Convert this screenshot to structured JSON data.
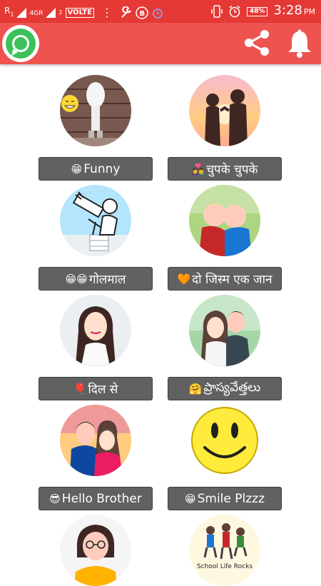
{
  "status_bar": {
    "sim1": "R",
    "sim1_sub": "1",
    "network": "4G",
    "network_r": "R",
    "sim2_sub": "2",
    "volte": "VOLTE",
    "battery": "48%",
    "time": "3:28",
    "ampm": "PM"
  },
  "app_bar": {
    "logo_icon": "whatsapp-logo",
    "share_icon": "share-icon",
    "bell_icon": "bell-icon",
    "colors": {
      "status": "#e53935",
      "toolbar": "#ef5350",
      "button": "#616161"
    }
  },
  "items": [
    {
      "emoji": "😁",
      "label": " Funny",
      "avatar": "laughing-egg-figure"
    },
    {
      "emoji": "👩‍❤️‍👨",
      "label": "चुपके चुपके",
      "avatar": "couple-silhouette-sunset"
    },
    {
      "emoji": "😁😁",
      "label": "गोलमाल",
      "avatar": "cartoon-telescope"
    },
    {
      "emoji": "🧡",
      "label": "दो जिस्म एक जान",
      "avatar": "kids-hugging"
    },
    {
      "emoji": "🎈",
      "label": "दिल से",
      "avatar": "girl-portrait"
    },
    {
      "emoji": "🤗",
      "label": "ప్రాస్యవేత్తలు",
      "avatar": "couple-portrait"
    },
    {
      "emoji": "😎",
      "label": "Hello Brother",
      "avatar": "brother-sister-portrait"
    },
    {
      "emoji": "😁",
      "label": " Smile Plzzz",
      "avatar": "yellow-smiley"
    },
    {
      "emoji": "",
      "label": "",
      "avatar": "girl-with-glasses"
    },
    {
      "emoji": "",
      "label": "",
      "avatar": "school-life-rocks",
      "avatar_text": "School Life Rocks"
    }
  ]
}
